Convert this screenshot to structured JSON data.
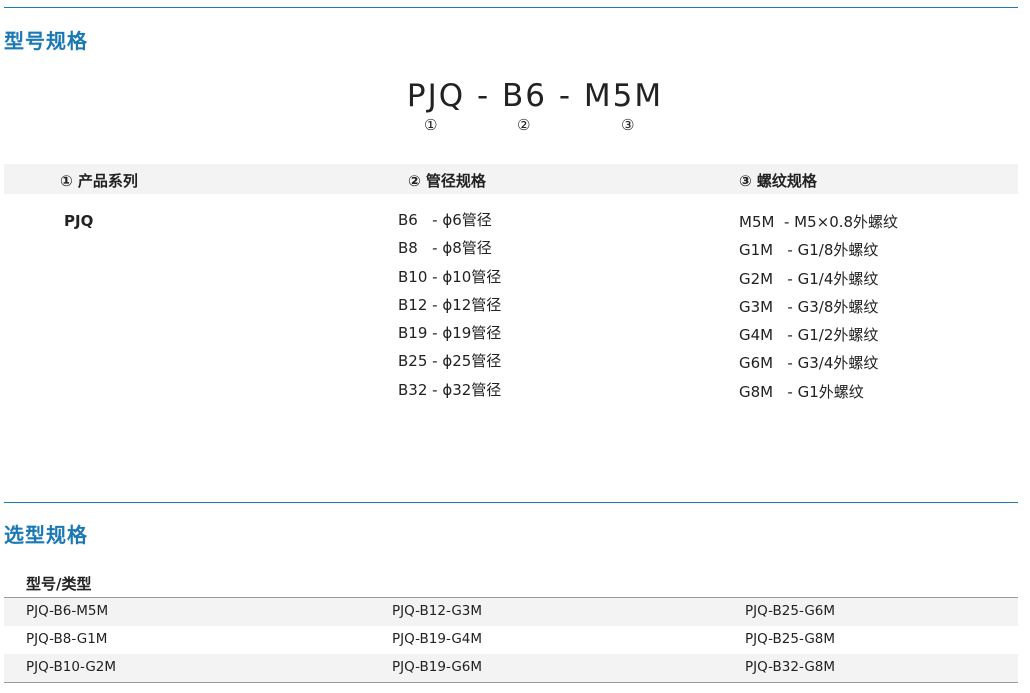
{
  "section1": {
    "title": "型号规格"
  },
  "model_code": {
    "text": "PJQ - B6 - M5M",
    "markers": [
      "①",
      "②",
      "③"
    ]
  },
  "columns": {
    "col1": {
      "header": "① 产品系列",
      "items": [
        "PJQ"
      ]
    },
    "col2": {
      "header": "② 管径规格",
      "items": [
        "B6   - ϕ6管径",
        "B8   - ϕ8管径",
        "B10 - ϕ10管径",
        "B12 - ϕ12管径",
        "B19 - ϕ19管径",
        "B25 - ϕ25管径",
        "B32 - ϕ32管径"
      ]
    },
    "col3": {
      "header": "③ 螺纹规格",
      "items": [
        "M5M  - M5×0.8外螺纹",
        "G1M   - G1/8外螺纹",
        "G2M   - G1/4外螺纹",
        "G3M   - G3/8外螺纹",
        "G4M   - G1/2外螺纹",
        "G6M   - G3/4外螺纹",
        "G8M   - G1外螺纹"
      ]
    }
  },
  "section2": {
    "title": "选型规格"
  },
  "selection_table": {
    "header": "型号/类型",
    "rows": [
      [
        "PJQ-B6-M5M",
        "PJQ-B12-G3M",
        "PJQ-B25-G6M"
      ],
      [
        "PJQ-B8-G1M",
        "PJQ-B19-G4M",
        "PJQ-B25-G8M"
      ],
      [
        "PJQ-B10-G2M",
        "PJQ-B19-G6M",
        "PJQ-B32-G8M"
      ]
    ]
  },
  "colors": {
    "accent": "#1a78b4",
    "rule": "#1b7bb5",
    "shade": "#f3f3f3"
  }
}
